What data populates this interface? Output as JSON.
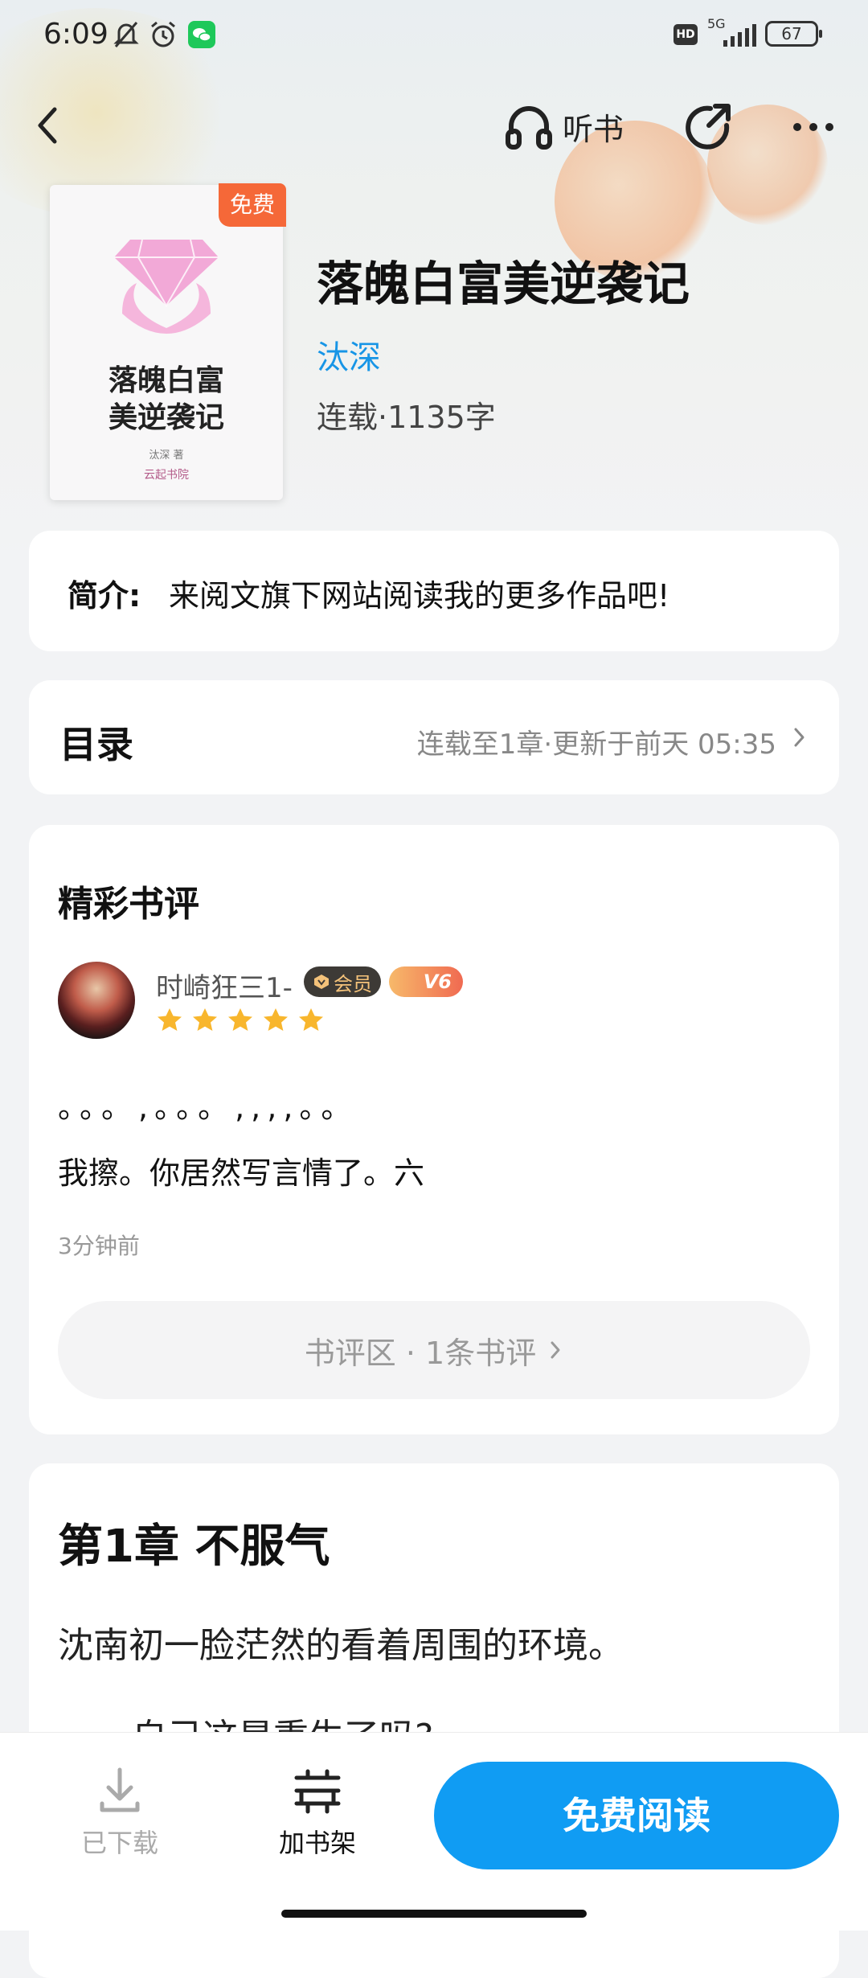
{
  "status_bar": {
    "time": "6:09",
    "network": "5G",
    "hd": "HD",
    "battery": "67"
  },
  "top_bar": {
    "listen_label": "听书"
  },
  "book": {
    "cover_title": "落魄白富美逆袭记",
    "cover_title_line1": "落魄白富",
    "cover_title_line2": "美逆袭记",
    "cover_author": "汰深 著",
    "cover_publisher": "云起书院",
    "free_badge": "免费",
    "title": "落魄白富美逆袭记",
    "author": "汰深",
    "meta": "连载·1135字"
  },
  "intro": {
    "label": "简介:",
    "text": "来阅文旗下网站阅读我的更多作品吧!"
  },
  "toc": {
    "label": "目录",
    "status": "连载至1章·更新于前天 05:35"
  },
  "reviews": {
    "header": "精彩书评",
    "items": [
      {
        "user": "时崎狂三1-",
        "vip_label": "会员",
        "level": "V6",
        "rating": 5,
        "line1": "。。。,。。。,,,,。。",
        "line2": "我擦。你居然写言情了。六",
        "time": "3分钟前"
      }
    ],
    "zone_label": "书评区 · 1条书评"
  },
  "chapter": {
    "title": "第1章 不服气",
    "paragraph1": "沈南初一脸茫然的看着周围的环境。",
    "paragraph2": "自己这是重生了吗?"
  },
  "bottom_bar": {
    "downloaded_label": "已下载",
    "add_shelf_label": "加书架",
    "read_label": "免费阅读"
  },
  "colors": {
    "accent": "#109cf3",
    "author_link": "#1795e6",
    "free_badge": "#f56838",
    "star": "#f8b62d"
  }
}
